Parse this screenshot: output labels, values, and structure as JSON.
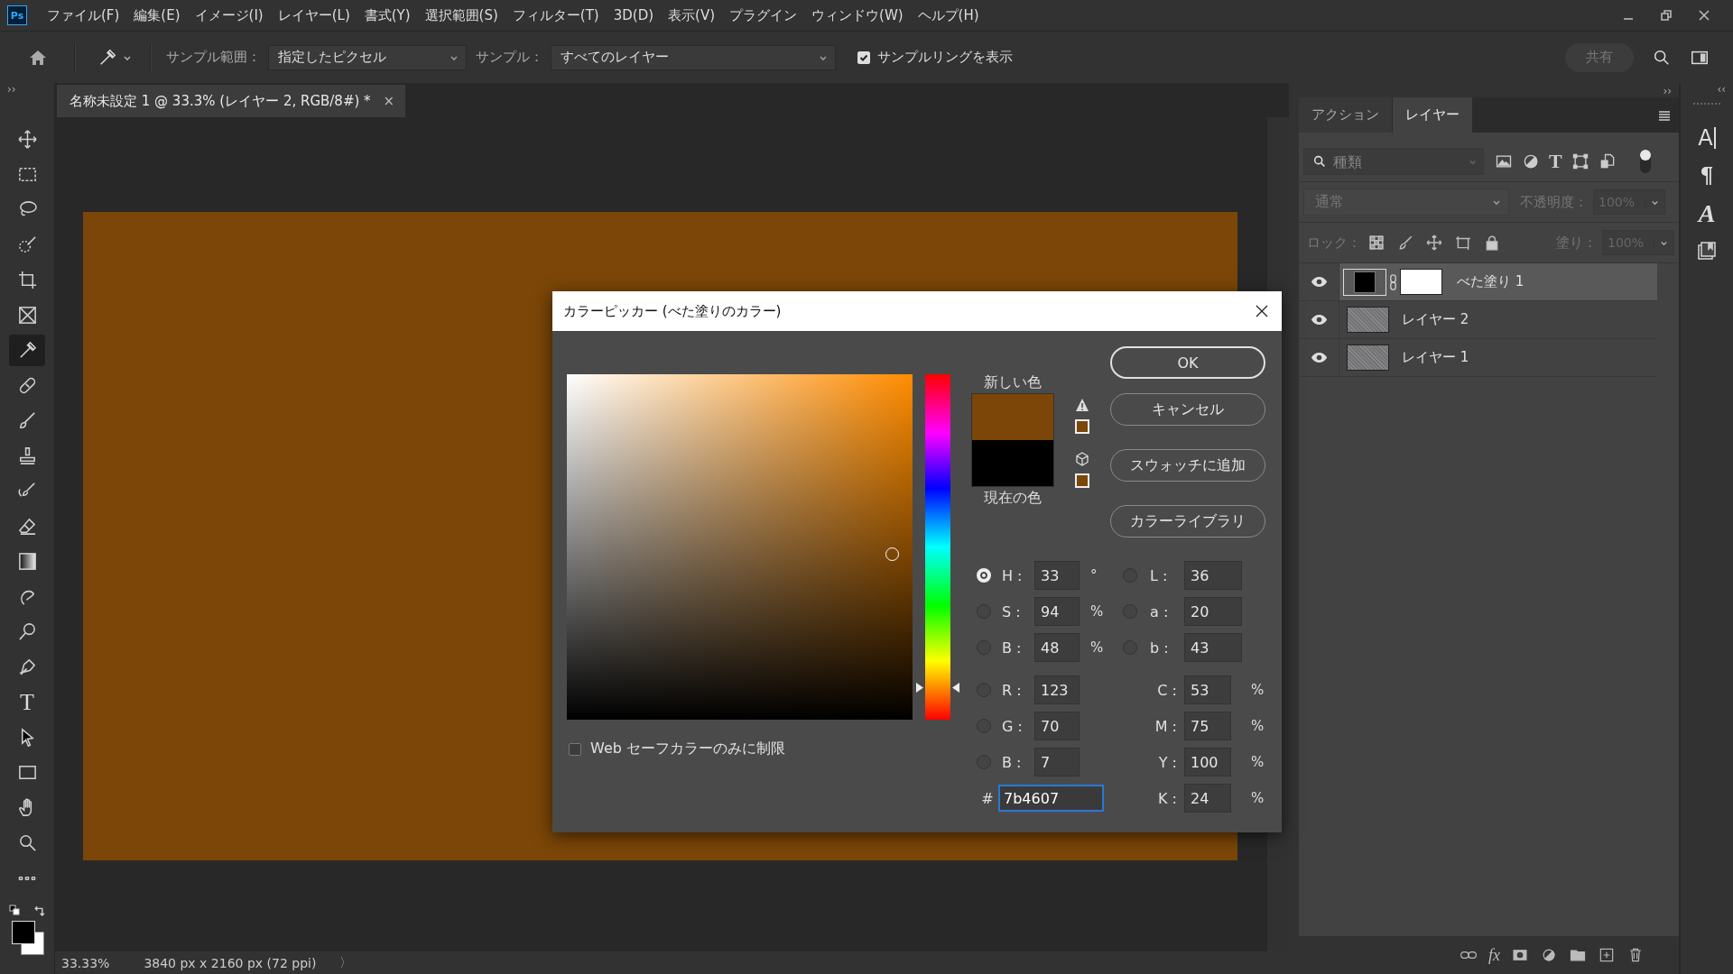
{
  "app_logo": "Ps",
  "menu_bar": {
    "items": [
      "ファイル(F)",
      "編集(E)",
      "イメージ(I)",
      "レイヤー(L)",
      "書式(Y)",
      "選択範囲(S)",
      "フィルター(T)",
      "3D(D)",
      "表示(V)",
      "プラグイン",
      "ウィンドウ(W)",
      "ヘルプ(H)"
    ]
  },
  "options_bar": {
    "sample_size": {
      "label": "サンプル範囲：",
      "value": "指定したピクセル"
    },
    "sample": {
      "label": "サンプル：",
      "value": "すべてのレイヤー"
    },
    "show_ring": {
      "label": "サンプルリングを表示",
      "checked": true
    },
    "share_button": {
      "label": "共有",
      "disabled": true
    }
  },
  "toolbar": {
    "collapse": "››",
    "tools": [
      {
        "kind": "move",
        "selected": false
      },
      {
        "kind": "marquee",
        "selected": false
      },
      {
        "kind": "lasso",
        "selected": false
      },
      {
        "kind": "quick-select",
        "selected": false
      },
      {
        "kind": "crop",
        "selected": false
      },
      {
        "kind": "frame",
        "selected": false
      },
      {
        "kind": "eyedropper",
        "selected": true
      },
      {
        "kind": "healing",
        "selected": false
      },
      {
        "kind": "brush",
        "selected": false
      },
      {
        "kind": "stamp",
        "selected": false
      },
      {
        "kind": "history-brush",
        "selected": false
      },
      {
        "kind": "eraser",
        "selected": false
      },
      {
        "kind": "gradient",
        "selected": false
      },
      {
        "kind": "smudge",
        "selected": false
      },
      {
        "kind": "dodge",
        "selected": false
      },
      {
        "kind": "pen",
        "selected": false
      },
      {
        "kind": "type",
        "glyph": "T",
        "selected": false
      },
      {
        "kind": "path-select",
        "selected": false
      },
      {
        "kind": "rectangle",
        "selected": false
      },
      {
        "kind": "hand",
        "selected": false
      },
      {
        "kind": "zoom",
        "selected": false
      },
      {
        "kind": "more",
        "selected": false
      }
    ]
  },
  "document_tab": {
    "title": "名称未設定 1 @ 33.3% (レイヤー 2, RGB/8#) *",
    "close": "×"
  },
  "status_bar": {
    "zoom": "33.33%",
    "size": "3840 px x 2160 px (72 ppi)",
    "arrow": "〉"
  },
  "layers_panel": {
    "collapse": "››",
    "tabs": [
      {
        "label": "アクション",
        "selected": false
      },
      {
        "label": "レイヤー",
        "selected": true
      }
    ],
    "filter": {
      "placeholder": "種類"
    },
    "type_filter": "T",
    "filter_toggle": {
      "on": true
    },
    "blend_mode": {
      "value": "通常",
      "disabled": true
    },
    "opacity": {
      "label": "不透明度：",
      "value": "100%",
      "disabled": true
    },
    "lock_label": "ロック：",
    "fill": {
      "label": "塗り：",
      "value": "100%",
      "disabled": true
    },
    "layers": [
      {
        "name": "べた塗り 1",
        "kind": "fill",
        "visible": true,
        "selected": true
      },
      {
        "name": "レイヤー 2",
        "kind": "pixel",
        "visible": true,
        "selected": false
      },
      {
        "name": "レイヤー 1",
        "kind": "pixel",
        "visible": true,
        "selected": false
      }
    ],
    "fx": "fx"
  },
  "side_strip": {
    "collapse": "‹‹",
    "icons": [
      {
        "kind": "character",
        "glyph": "A"
      },
      {
        "kind": "paragraph",
        "glyph": "¶"
      },
      {
        "kind": "glyphs",
        "glyph": "A"
      },
      {
        "kind": "library"
      }
    ]
  },
  "color_picker": {
    "title": "カラーピッカー (べた塗りのカラー)",
    "new_label": "新しい色",
    "current_label": "現在の色",
    "buttons": [
      {
        "label": "OK",
        "default": true
      },
      {
        "label": "キャンセル",
        "default": false
      },
      {
        "label": "スウォッチに追加",
        "default": false
      },
      {
        "label": "カラーライブラリ",
        "default": false
      }
    ],
    "web_only": {
      "label": "Web セーフカラーのみに制限",
      "checked": false
    },
    "hue_slider": {
      "level": 0.092
    },
    "hsb": [
      {
        "label": "H :",
        "value": "33",
        "unit": "°",
        "selected": true
      },
      {
        "label": "S :",
        "value": "94",
        "unit": "%",
        "selected": false
      },
      {
        "label": "B :",
        "value": "48",
        "unit": "%",
        "selected": false
      }
    ],
    "lab": [
      {
        "label": "L :",
        "value": "36",
        "selected": false
      },
      {
        "label": "a :",
        "value": "20",
        "selected": false
      },
      {
        "label": "b :",
        "value": "43",
        "selected": false
      }
    ],
    "rgb": [
      {
        "label": "R :",
        "value": "123",
        "selected": false
      },
      {
        "label": "G :",
        "value": "70",
        "selected": false
      },
      {
        "label": "B :",
        "value": "7",
        "selected": false
      }
    ],
    "cmyk": [
      {
        "label": "C :",
        "value": "53",
        "unit": "%"
      },
      {
        "label": "M :",
        "value": "75",
        "unit": "%"
      },
      {
        "label": "Y :",
        "value": "100",
        "unit": "%"
      },
      {
        "label": "K :",
        "value": "24",
        "unit": "%"
      }
    ],
    "hex": {
      "label": "#",
      "value": "7b4607"
    }
  }
}
